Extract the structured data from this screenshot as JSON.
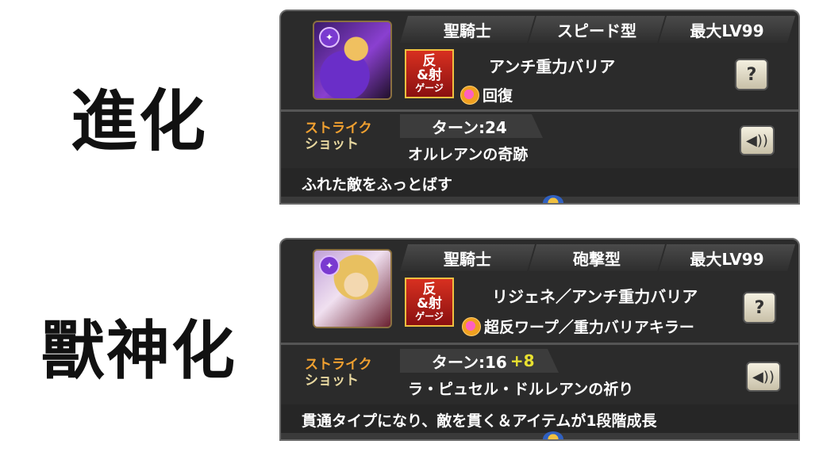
{
  "labels": {
    "evolution": "進化",
    "beast_god": "獸神化"
  },
  "cards": [
    {
      "header": {
        "race": "聖騎士",
        "type": "スピード型",
        "max_level": "最大LV99"
      },
      "gauge": {
        "line1": "反",
        "line2": "&射",
        "line3": "ゲージ"
      },
      "ability": "アンチ重力バリア",
      "gauge_ability": "回復",
      "strike_shot": {
        "label_line1": "ストライク",
        "label_line2": "ショット",
        "turns": "ターン:24",
        "turns_plus": "",
        "name": "オルレアンの奇跡"
      },
      "description": "ふれた敵をふっとばす"
    },
    {
      "header": {
        "race": "聖騎士",
        "type": "砲撃型",
        "max_level": "最大LV99"
      },
      "gauge": {
        "line1": "反",
        "line2": "&射",
        "line3": "ゲージ"
      },
      "ability": "リジェネ／アンチ重力バリア",
      "gauge_ability": "超反ワープ／重力バリアキラー",
      "strike_shot": {
        "label_line1": "ストライク",
        "label_line2": "ショット",
        "turns": "ターン:16",
        "turns_plus": "+8",
        "name": "ラ・ピュセル・ドルレアンの祈り"
      },
      "description": "貫通タイプになり、敵を貫く＆アイテムが1段階成長"
    }
  ],
  "icons": {
    "help": "question-icon",
    "voice": "speaker-icon",
    "element": "dark-element-icon"
  }
}
